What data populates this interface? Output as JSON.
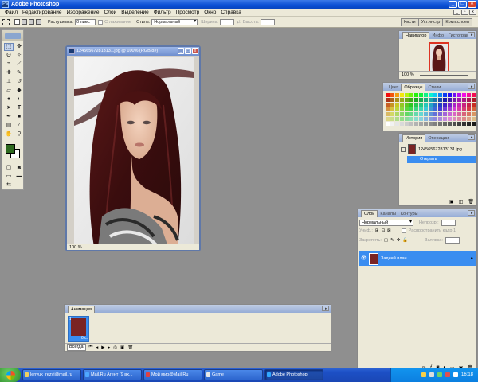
{
  "app": {
    "title": "Adobe Photoshop"
  },
  "menu": [
    "Файл",
    "Редактирование",
    "Изображение",
    "Слой",
    "Выделение",
    "Фильтр",
    "Просмотр",
    "Окно",
    "Справка"
  ],
  "options": {
    "feather_label": "Растушевка:",
    "feather_value": "0 пикс.",
    "antialias_label": "Сглаживание",
    "style_label": "Стиль:",
    "style_value": "Нормальный",
    "width_label": "Ширина:",
    "height_label": "Высота:",
    "brush_tabs": [
      "Кисти",
      "Уст.инстр",
      "Комп.слоев"
    ]
  },
  "document": {
    "title": "124565672813131.jpg @ 100% (RGB/8#)",
    "zoom": "100 %"
  },
  "navigator": {
    "tabs": [
      "Навигатор",
      "Инфо",
      "Гистограмма"
    ],
    "zoom": "100 %"
  },
  "swatches": {
    "tabs": [
      "Цвет",
      "Образцы",
      "Стили"
    ]
  },
  "history": {
    "tabs": [
      "История",
      "Операции"
    ],
    "snapshot": "124565672813131.jpg",
    "state": "Открыть"
  },
  "layers": {
    "tabs": [
      "Слои",
      "Каналы",
      "Контуры"
    ],
    "blend_mode": "Нормальный",
    "opacity_label": "Непрозр.:",
    "unify_label": "Униф.:",
    "propagate_label": "Распространить кадр 1",
    "lock_label": "Закрепить:",
    "fill_label": "Заливка:",
    "layer_name": "Задний план"
  },
  "animation": {
    "tab": "Анимация",
    "frame_number": "1",
    "frame_delay": "0 с.",
    "loop": "Всегда"
  },
  "taskbar": {
    "buttons": [
      {
        "label": "lenyuk_rezvi@mail.ru",
        "icon_color": "#f0d060"
      },
      {
        "label": "Mail.Ru Агент (9 вх...",
        "icon_color": "#4fa8ff"
      },
      {
        "label": "Мой мир@Mail.Ru",
        "icon_color": "#e04040"
      },
      {
        "label": "Game",
        "icon_color": "#e8e8e8"
      },
      {
        "label": "Adobe Photoshop",
        "icon_color": "#31a8ff"
      }
    ],
    "clock": "16:18"
  }
}
